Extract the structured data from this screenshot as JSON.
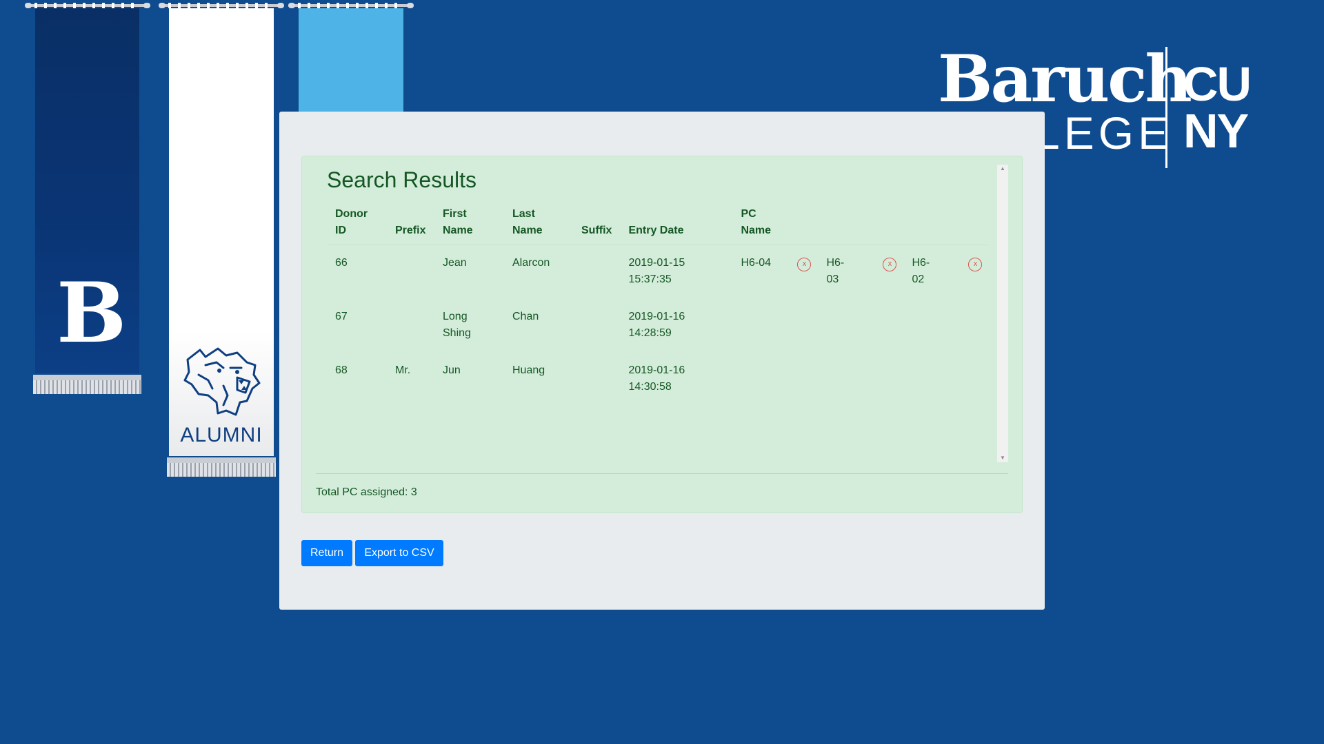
{
  "logo": {
    "baruch": "Baruch",
    "college": "LEGE",
    "cuny_line1": "CU",
    "cuny_line2": "NY"
  },
  "banners": {
    "navy_letter": "B",
    "alumni_label": "ALUMNI"
  },
  "results": {
    "title": "Search Results",
    "columns": {
      "donor_id": [
        "Donor",
        "ID"
      ],
      "prefix": "Prefix",
      "first_name": [
        "First",
        "Name"
      ],
      "last_name": [
        "Last",
        "Name"
      ],
      "suffix": "Suffix",
      "entry_date": "Entry Date",
      "pc_name": [
        "PC",
        "Name"
      ]
    },
    "rows": [
      {
        "donor_id": "66",
        "prefix": "",
        "first_name": "Jean",
        "last_name": "Alarcon",
        "suffix": "",
        "entry_date": [
          "2019-01-15",
          "15:37:35"
        ],
        "pcs": [
          {
            "name": "H6-04",
            "remove": "x"
          },
          {
            "name": "H6-03",
            "remove": "x"
          },
          {
            "name": "H6-02",
            "remove": "x"
          }
        ]
      },
      {
        "donor_id": "67",
        "prefix": "",
        "first_name": "Long Shing",
        "last_name": "Chan",
        "suffix": "",
        "entry_date": [
          "2019-01-16",
          "14:28:59"
        ],
        "pcs": []
      },
      {
        "donor_id": "68",
        "prefix": "Mr.",
        "first_name": "Jun",
        "last_name": "Huang",
        "suffix": "",
        "entry_date": [
          "2019-01-16",
          "14:30:58"
        ],
        "pcs": []
      }
    ],
    "total_label": "Total PC assigned: 3"
  },
  "buttons": {
    "return_label": "Return",
    "export_label": "Export to CSV"
  },
  "colors": {
    "background": "#0f4c8f",
    "panel": "#e9ecef",
    "success_bg": "#d4edda",
    "success_text": "#155724",
    "primary": "#007bff",
    "danger": "#d9534f"
  },
  "icons": {
    "remove": "remove-pc-icon",
    "mascot": "wildcat-icon"
  }
}
